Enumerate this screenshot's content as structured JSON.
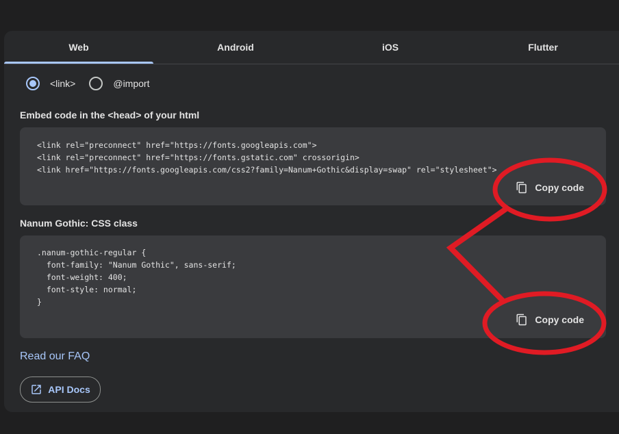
{
  "tabs": [
    {
      "label": "Web",
      "selected": true
    },
    {
      "label": "Android",
      "selected": false
    },
    {
      "label": "iOS",
      "selected": false
    },
    {
      "label": "Flutter",
      "selected": false
    }
  ],
  "embed_type": {
    "options": [
      {
        "label": "<link>",
        "selected": true
      },
      {
        "label": "@import",
        "selected": false
      }
    ]
  },
  "embed_section": {
    "title": "Embed code in the <head> of your html",
    "code": "<link rel=\"preconnect\" href=\"https://fonts.googleapis.com\">\n<link rel=\"preconnect\" href=\"https://fonts.gstatic.com\" crossorigin>\n<link href=\"https://fonts.googleapis.com/css2?family=Nanum+Gothic&display=swap\" rel=\"stylesheet\">",
    "copy_label": "Copy code"
  },
  "css_section": {
    "title": "Nanum Gothic: CSS class",
    "code": ".nanum-gothic-regular {\n  font-family: \"Nanum Gothic\", sans-serif;\n  font-weight: 400;\n  font-style: normal;\n}",
    "copy_label": "Copy code"
  },
  "faq_link": "Read our FAQ",
  "api_docs_button": "API Docs",
  "colors": {
    "accent": "#a8c7fa",
    "panel": "#28292b",
    "code_bg": "#3a3b3e",
    "annotation": "#e01b24"
  },
  "icons": {
    "copy": "copy-icon",
    "external_link": "open-in-new-icon"
  }
}
